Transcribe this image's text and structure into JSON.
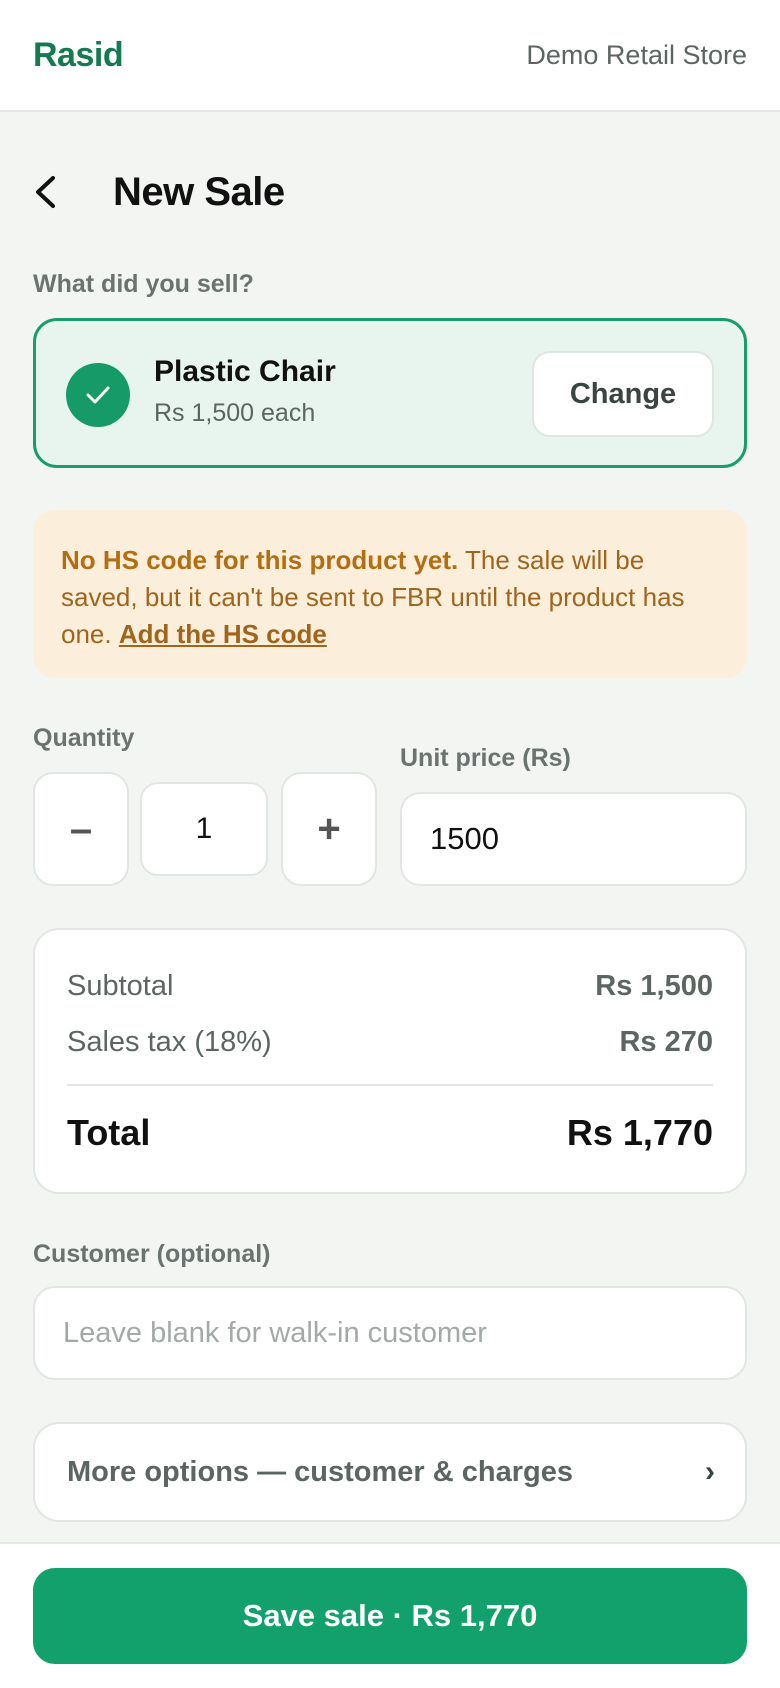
{
  "header": {
    "brand": "Rasid",
    "store_name": "Demo Retail Store"
  },
  "page": {
    "title": "New Sale",
    "back_icon": "chevron-left-icon"
  },
  "product_section": {
    "label": "What did you sell?",
    "selected_product": {
      "name": "Plastic Chair",
      "price_text": "Rs 1,500 each",
      "icon": "check-icon"
    },
    "change_label": "Change"
  },
  "warning": {
    "title": "No HS code for this product yet.",
    "message": " The sale will be saved, but it can't be sent to FBR until the product has one. ",
    "link_label": "Add the HS code"
  },
  "quantity": {
    "label": "Quantity",
    "value": "1",
    "decrement_label": "–",
    "increment_label": "+"
  },
  "unit_price": {
    "label": "Unit price (Rs)",
    "value": "1500"
  },
  "summary": {
    "subtotal_label": "Subtotal",
    "subtotal_value": "Rs 1,500",
    "tax_label": "Sales tax (18%)",
    "tax_value": "Rs 270",
    "total_label": "Total",
    "total_value": "Rs 1,770"
  },
  "customer": {
    "label": "Customer (optional)",
    "placeholder": "Leave blank for walk-in customer",
    "value": ""
  },
  "more_options": {
    "label": "More options — customer & charges",
    "chevron": "›"
  },
  "footer": {
    "save_label": "Save sale · Rs 1,770"
  },
  "colors": {
    "brand": "#157a52",
    "accent": "#12a06c",
    "warning_bg": "#fbeedb",
    "warning_text": "#a0651c"
  }
}
